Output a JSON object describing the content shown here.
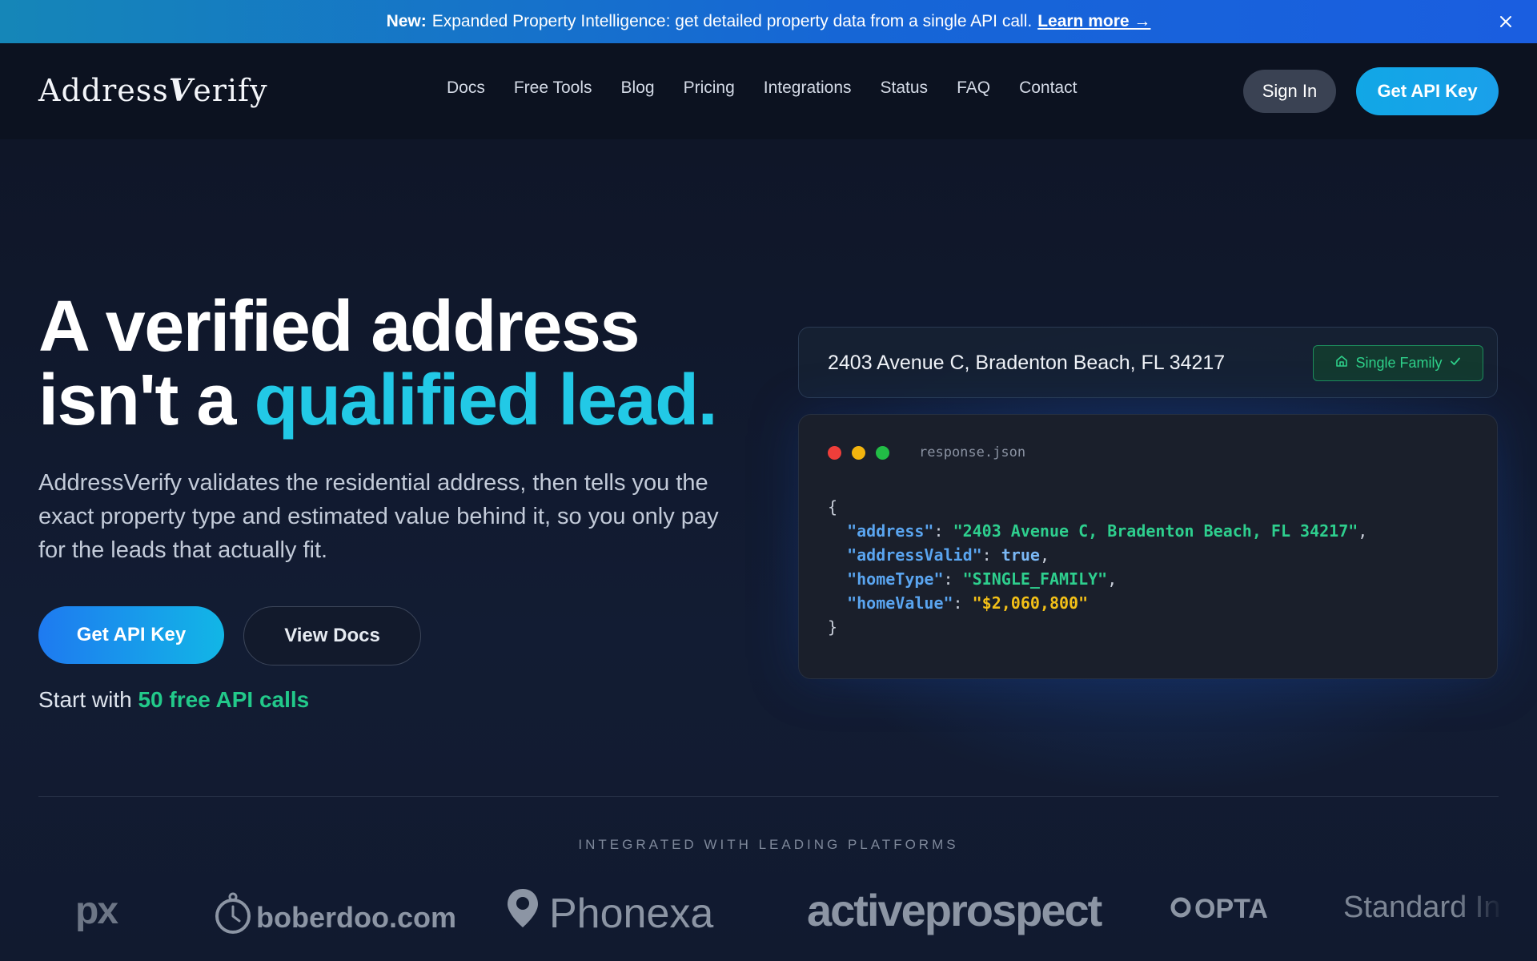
{
  "announcement": {
    "label": "New:",
    "text": "Expanded Property Intelligence: get detailed property data from a single API call.",
    "link": "Learn more →"
  },
  "nav": {
    "logo_main": "Address",
    "logo_v": "V",
    "logo_rest": "erify",
    "items": [
      "Docs",
      "Free Tools",
      "Blog",
      "Pricing",
      "Integrations",
      "Status",
      "FAQ",
      "Contact"
    ],
    "sign_in": "Sign In",
    "get_api_key": "Get API Key"
  },
  "hero": {
    "headline_line1": "A verified address",
    "headline_line2_plain": "isn't a ",
    "headline_line2_accent": "qualified lead.",
    "subheadline": "AddressVerify validates the residential address, then tells you the exact property type and estimated value behind it, so you only pay for the leads that actually fit.",
    "primary_button": "Get API Key",
    "secondary_button": "View Docs",
    "free_prefix": "Start with ",
    "free_highlight": "50 free API calls"
  },
  "demo": {
    "address": "2403 Avenue C, Bradenton Beach, FL 34217",
    "badge": "Single Family",
    "filename": "response.json",
    "response": {
      "open": "{",
      "close": "}",
      "address_key": "\"address\"",
      "address_val": "\"2403 Avenue C, Bradenton Beach, FL 34217\"",
      "valid_key": "\"addressValid\"",
      "valid_val": "true",
      "type_key": "\"homeType\"",
      "type_val": "\"SINGLE_FAMILY\"",
      "value_key": "\"homeValue\"",
      "value_val": "\"$2,060,800\""
    }
  },
  "integrations": {
    "heading": "INTEGRATED WITH LEADING PLATFORMS",
    "logos": [
      "px",
      "boberdoo.com",
      "Phonexa",
      "activeprospect",
      "OPTA",
      "Standard In"
    ]
  },
  "colors": {
    "accent_cyan": "#22c9e6",
    "accent_green": "#22c98a",
    "bg": "#0f1628"
  }
}
